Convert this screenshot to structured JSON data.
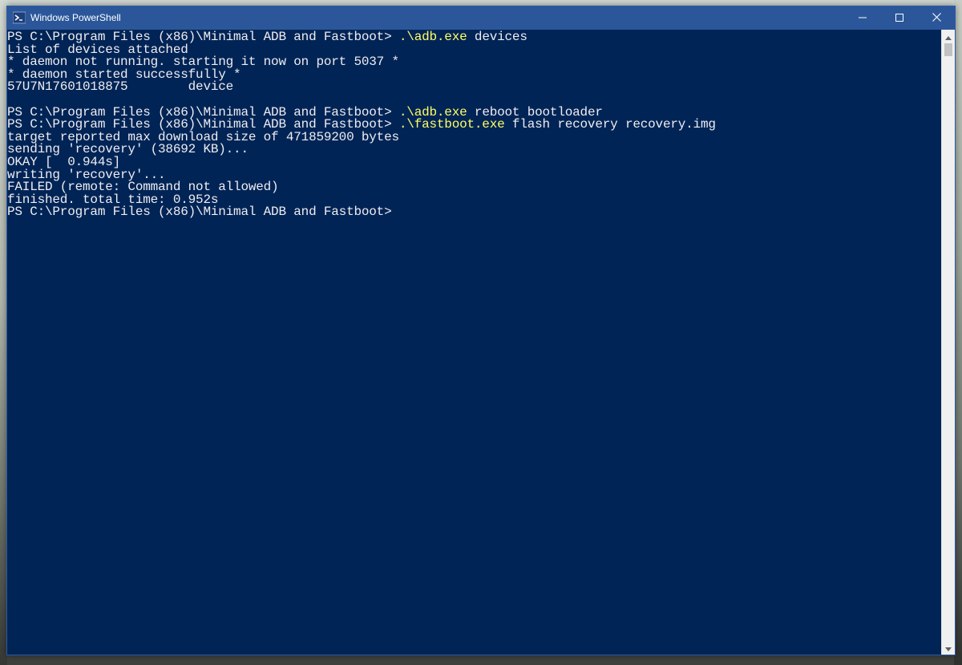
{
  "window": {
    "title": "Windows PowerShell",
    "icon": "powershell-icon",
    "colors": {
      "titlebar": "#2b579a",
      "console_background": "#012456",
      "console_text": "#eeedf0",
      "command_text": "#ffff66"
    }
  },
  "caption_buttons": {
    "minimize": "minimize-icon",
    "maximize": "maximize-icon",
    "close": "close-icon"
  },
  "console": {
    "lines": [
      {
        "prompt": "PS C:\\Program Files (x86)\\Minimal ADB and Fastboot> ",
        "cmd": ".\\adb.exe",
        "args": " devices"
      },
      {
        "text": "List of devices attached"
      },
      {
        "text": "* daemon not running. starting it now on port 5037 *"
      },
      {
        "text": "* daemon started successfully *"
      },
      {
        "text": "57U7N17601018875        device"
      },
      {
        "text": ""
      },
      {
        "prompt": "PS C:\\Program Files (x86)\\Minimal ADB and Fastboot> ",
        "cmd": ".\\adb.exe",
        "args": " reboot bootloader"
      },
      {
        "prompt": "PS C:\\Program Files (x86)\\Minimal ADB and Fastboot> ",
        "cmd": ".\\fastboot.exe",
        "args": " flash recovery recovery.img"
      },
      {
        "text": "target reported max download size of 471859200 bytes"
      },
      {
        "text": "sending 'recovery' (38692 KB)..."
      },
      {
        "text": "OKAY [  0.944s]"
      },
      {
        "text": "writing 'recovery'..."
      },
      {
        "text": "FAILED (remote: Command not allowed)"
      },
      {
        "text": "finished. total time: 0.952s"
      },
      {
        "prompt": "PS C:\\Program Files (x86)\\Minimal ADB and Fastboot>",
        "cmd": "",
        "args": ""
      }
    ]
  },
  "scrollbar": {
    "up_icon": "scroll-up-arrow-icon",
    "down_icon": "scroll-down-arrow-icon"
  }
}
